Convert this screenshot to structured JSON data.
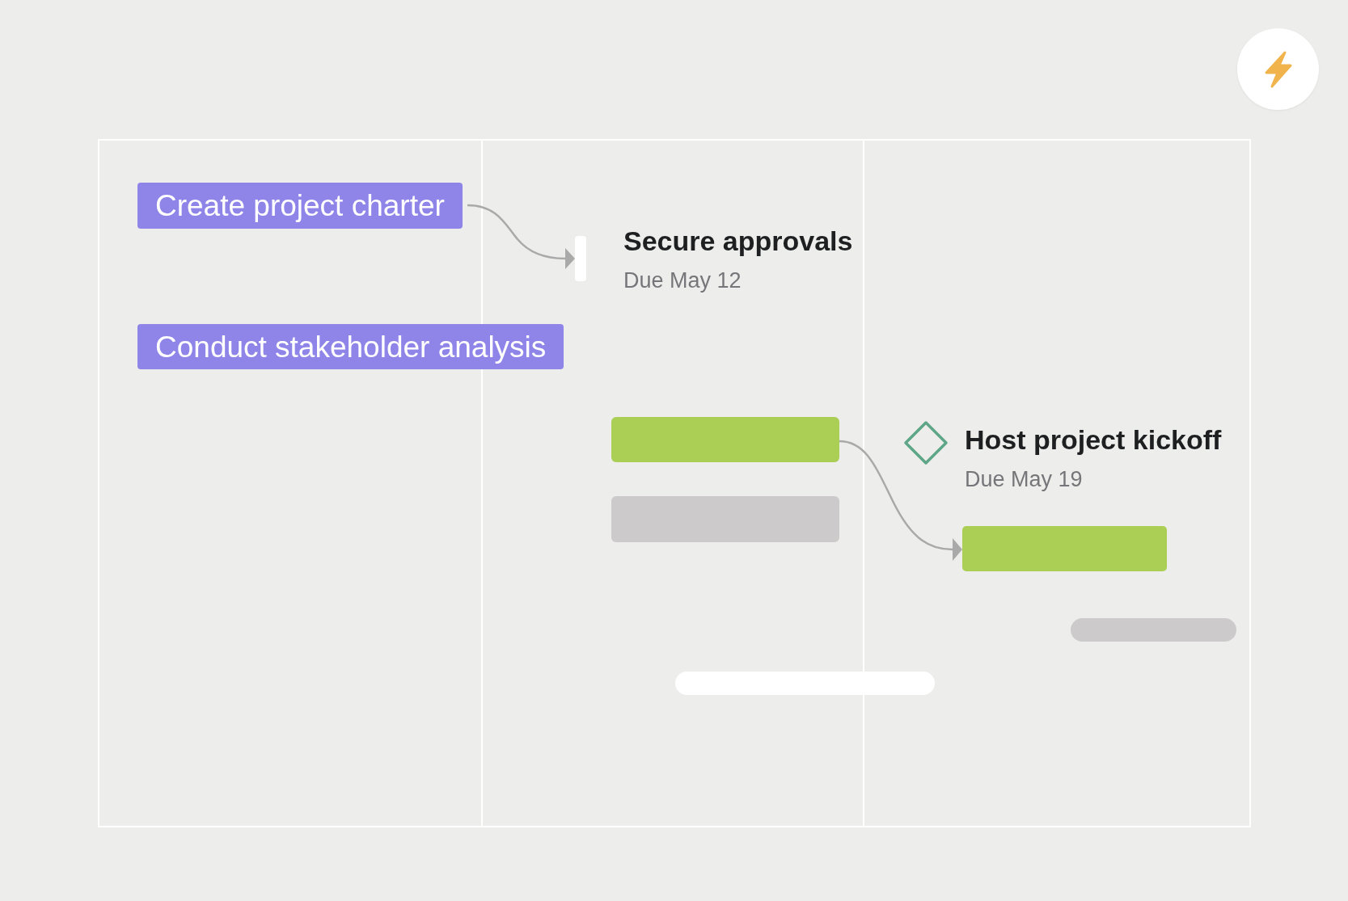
{
  "tasks": [
    {
      "label": "Create project charter"
    },
    {
      "label": "Conduct stakeholder analysis"
    }
  ],
  "milestones": [
    {
      "title": "Secure approvals",
      "due": "Due May 12",
      "kind": "marker"
    },
    {
      "title": "Host project kickoff",
      "due": "Due May 19",
      "kind": "diamond"
    }
  ],
  "bars": [
    {
      "color": "#abcf54"
    },
    {
      "color": "#cccacb"
    },
    {
      "color": "#abcf54"
    },
    {
      "color": "#cccacb"
    },
    {
      "color": "#ffffff"
    }
  ]
}
